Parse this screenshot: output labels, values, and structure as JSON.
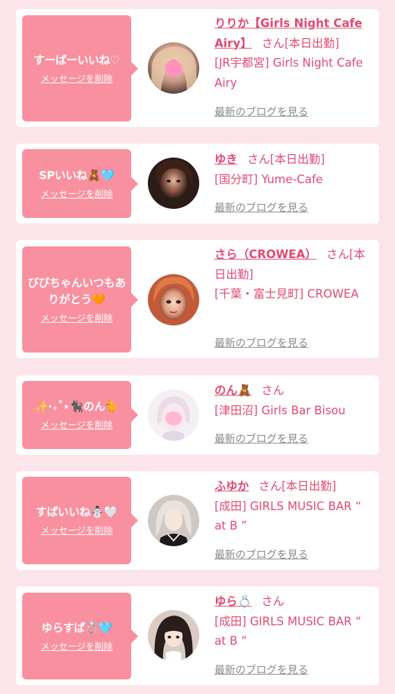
{
  "cards": [
    {
      "message": "すーぱーいいね♡",
      "delete_label": "メッセージを削除",
      "name": "りりか【Girls Night Cafe Airy】",
      "honorific": "さん",
      "status": "[本日出勤]",
      "shop": "[JR宇都宮] Girls Night Cafe Airy",
      "blog_label": "最新のブログを見る"
    },
    {
      "message": "SPいいね🧸🩵",
      "delete_label": "メッセージを削除",
      "name": "ゆき",
      "honorific": "さん",
      "status": "[本日出勤]",
      "shop": "[国分町] Yume-Cafe",
      "blog_label": "最新のブログを見る"
    },
    {
      "message": "びびちゃんいつもありがとう🧡",
      "delete_label": "メッセージを削除",
      "name": "さら（CROWEA）",
      "honorific": "さん",
      "status": "[本日出勤]",
      "shop": "[千葉・富士見町] CROWEA",
      "blog_label": "最新のブログを見る"
    },
    {
      "message": "✨‧₊˚⋆🐈‍⬛のん🐈",
      "delete_label": "メッセージを削除",
      "name": "のん🧸",
      "honorific": "さん",
      "status": "",
      "shop": "[津田沼] Girls Bar Bisou",
      "blog_label": "最新のブログを見る"
    },
    {
      "message": "すぱいいね☃️🤍",
      "delete_label": "メッセージを削除",
      "name": "ふゆか",
      "honorific": "さん",
      "status": "[本日出勤]",
      "shop": "[成田] GIRLS MUSIC BAR “ at B ”",
      "blog_label": "最新のブログを見る"
    },
    {
      "message": "ゆらすぱ💍🩵",
      "delete_label": "メッセージを削除",
      "name": "ゆら💍",
      "honorific": "さん",
      "status": "",
      "shop": "[成田] GIRLS MUSIC BAR “ at B ”",
      "blog_label": "最新のブログを見る"
    }
  ],
  "colors": {
    "page_bg": "#fce5ea",
    "bubble_bg": "#f8909f",
    "accent_text": "#e24a72",
    "link_gray": "#8a8a8a"
  }
}
